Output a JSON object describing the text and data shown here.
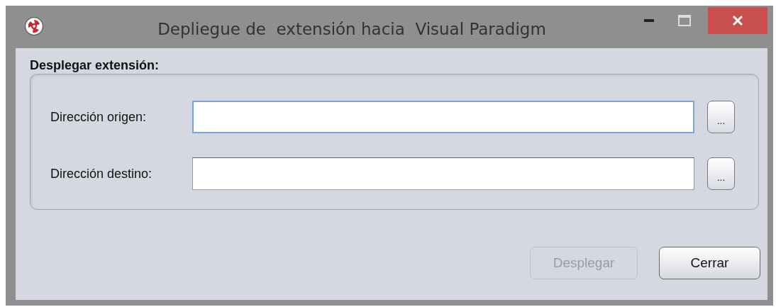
{
  "window": {
    "title": "Depliegue de  extensión hacia  Visual Paradigm"
  },
  "group": {
    "title": "Desplegar extensión:"
  },
  "fields": [
    {
      "label": "Dirección origen:",
      "focused": true,
      "browse": "..."
    },
    {
      "label": "Dirección destino:",
      "focused": false,
      "browse": "..."
    }
  ],
  "buttons": [
    {
      "label": "Desplegar",
      "disabled": true
    },
    {
      "label": "Cerrar",
      "disabled": false
    }
  ]
}
